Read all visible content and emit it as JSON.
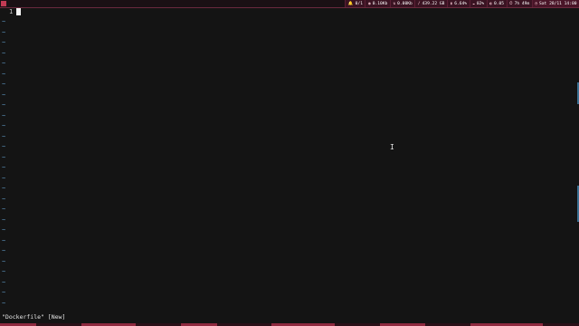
{
  "topbar": {
    "status": [
      {
        "icon": "bell-icon",
        "glyph": "🔔",
        "text": "0/1"
      },
      {
        "icon": "disk-icon",
        "glyph": "◉",
        "text": "0.10Kb"
      },
      {
        "icon": "network-icon",
        "glyph": "⇅",
        "text": "0.00Kb"
      },
      {
        "icon": "storage-icon",
        "glyph": "/",
        "text": "439.22 GB"
      },
      {
        "icon": "memory-icon",
        "glyph": "▮",
        "text": "6.64%"
      },
      {
        "icon": "cpu-icon",
        "glyph": "☁",
        "text": "02%"
      },
      {
        "icon": "load-icon",
        "glyph": "◐",
        "text": "0.05"
      },
      {
        "icon": "uptime-icon",
        "glyph": "⏱",
        "text": "7h 49m"
      },
      {
        "icon": "clock-icon",
        "glyph": "◷",
        "text": "Sat 28/11 14:00"
      }
    ]
  },
  "editor": {
    "line_number": "1",
    "tilde": "~",
    "filler_line_count": 28
  },
  "cmdline": "\"Dockerfile\" [New]",
  "colors": {
    "accent": "#c23a54",
    "background": "#141414",
    "tilde": "#5a8fb8"
  }
}
